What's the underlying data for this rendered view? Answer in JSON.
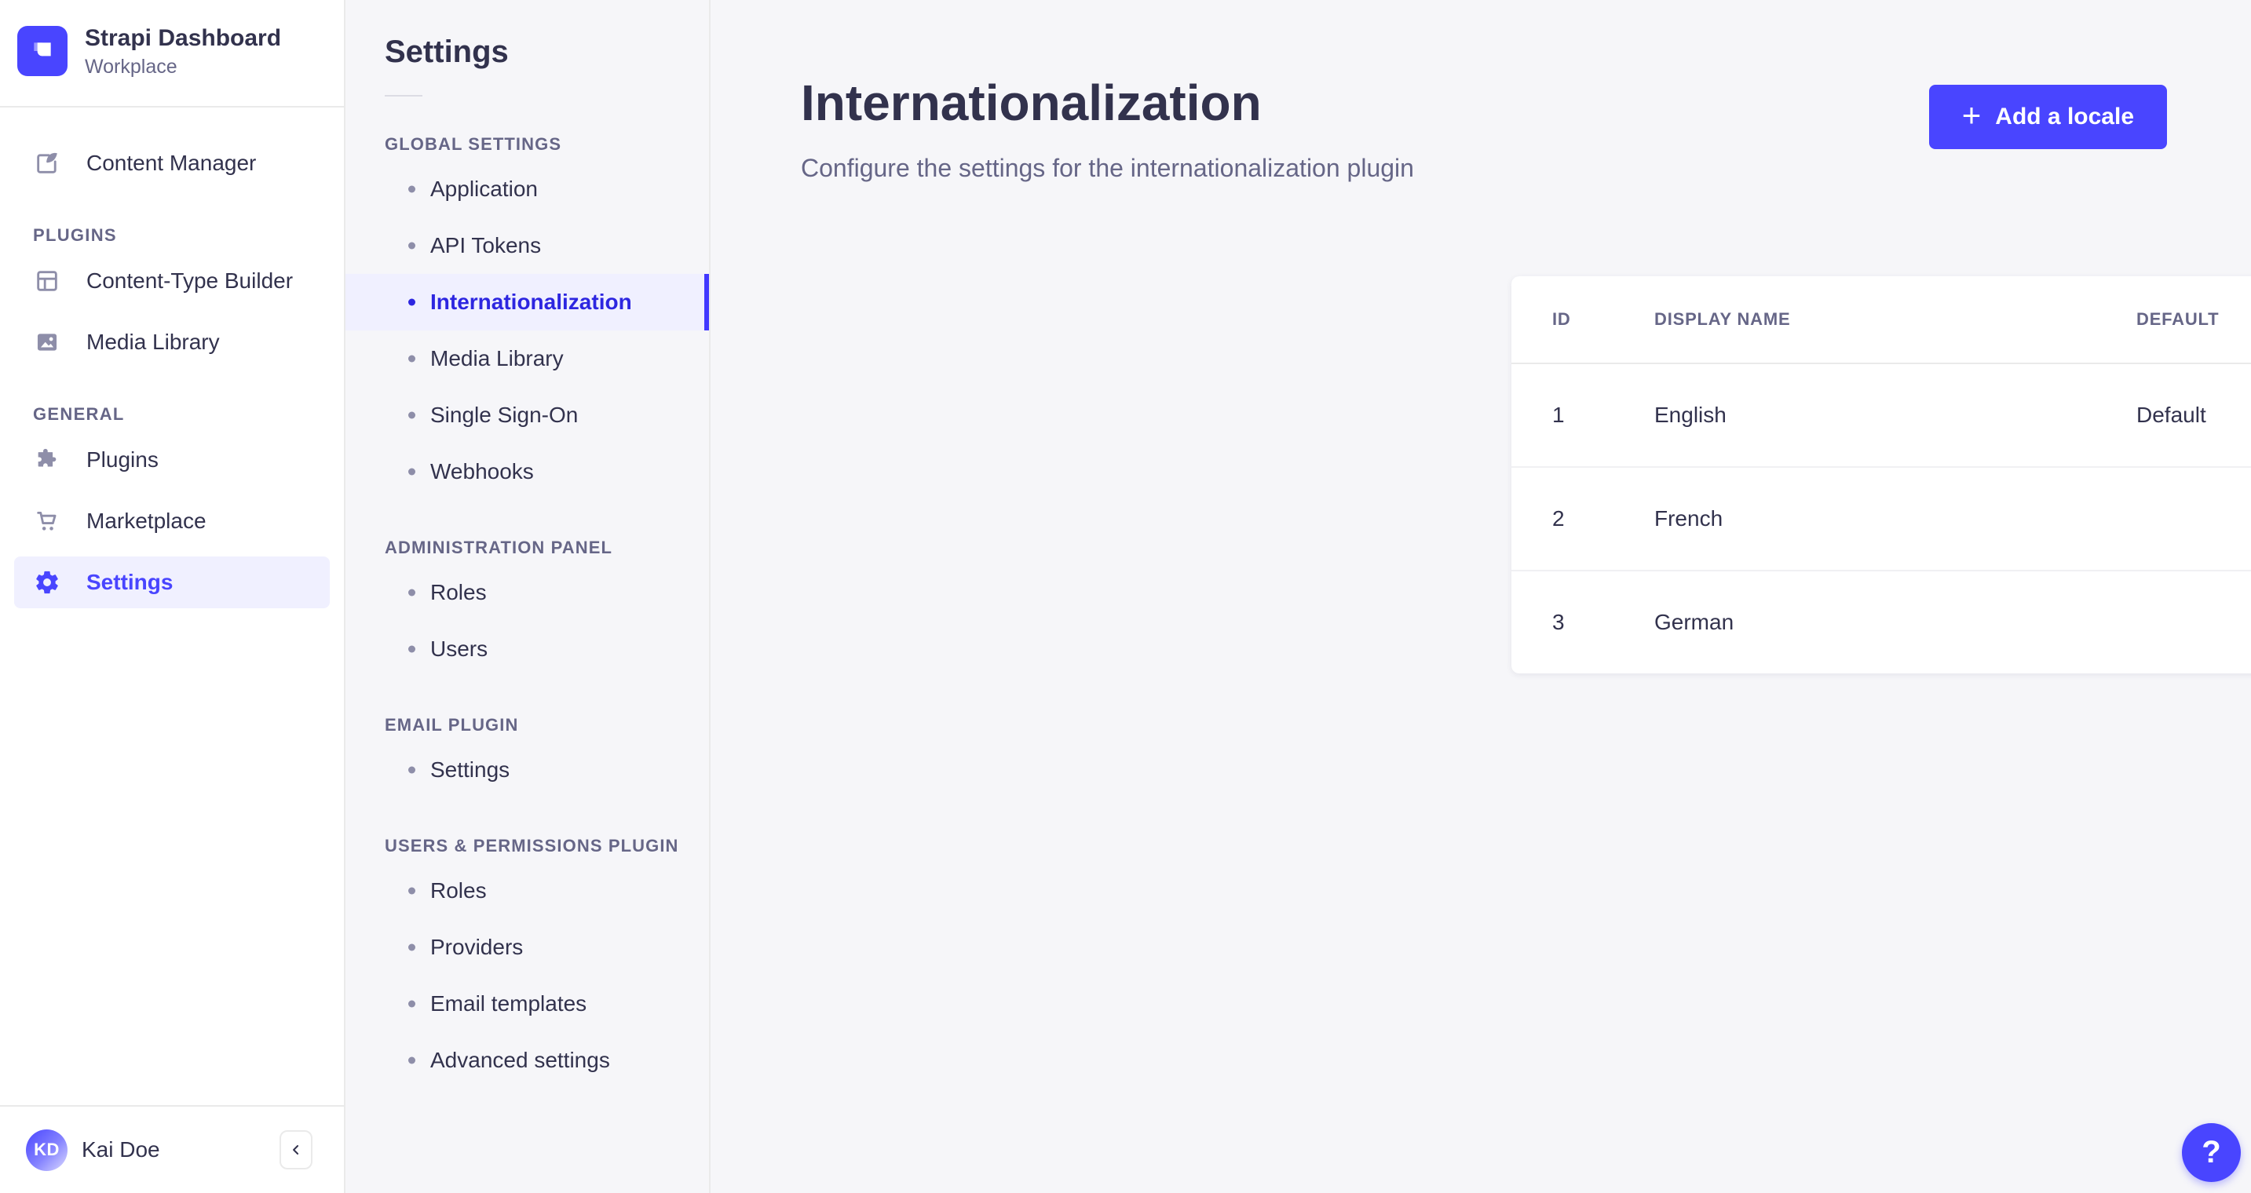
{
  "brand": {
    "name": "Strapi Dashboard",
    "workspace": "Workplace"
  },
  "colors": {
    "accent": "#4945ff",
    "accent_dark": "#2d26e0",
    "active_bg": "#f0f0ff",
    "text_dark": "#32324d",
    "text_muted": "#666687",
    "icon_gray": "#8e8ea9",
    "border": "#eaeaea",
    "panel_bg": "#f6f6f9"
  },
  "sidebar": {
    "primary_item": "Content Manager",
    "sections": [
      {
        "title": "PLUGINS",
        "items": [
          "Content-Type Builder",
          "Media Library"
        ]
      },
      {
        "title": "GENERAL",
        "items": [
          "Plugins",
          "Marketplace",
          "Settings"
        ]
      }
    ],
    "active_item": "Settings",
    "user": {
      "initials": "KD",
      "name": "Kai Doe"
    },
    "collapse_glyph": "‹"
  },
  "subnav": {
    "title": "Settings",
    "active_item": "Internationalization",
    "sections": [
      {
        "title": "GLOBAL SETTINGS",
        "items": [
          "Application",
          "API Tokens",
          "Internationalization",
          "Media Library",
          "Single Sign-On",
          "Webhooks"
        ]
      },
      {
        "title": "ADMINISTRATION PANEL",
        "items": [
          "Roles",
          "Users"
        ]
      },
      {
        "title": "EMAIL PLUGIN",
        "items": [
          "Settings"
        ]
      },
      {
        "title": "USERS & PERMISSIONS PLUGIN",
        "items": [
          "Roles",
          "Providers",
          "Email templates",
          "Advanced settings"
        ]
      }
    ]
  },
  "main": {
    "title": "Internationalization",
    "subtitle": "Configure the settings for the internationalization plugin",
    "add_button_plus": "+",
    "add_button_label": "Add a locale",
    "table": {
      "columns": [
        "ID",
        "DISPLAY NAME",
        "DEFAULT"
      ],
      "rows": [
        {
          "id": "1",
          "display_name": "English",
          "default": "Default"
        },
        {
          "id": "2",
          "display_name": "French",
          "default": ""
        },
        {
          "id": "3",
          "display_name": "German",
          "default": ""
        }
      ]
    }
  },
  "help": {
    "label": "?"
  }
}
